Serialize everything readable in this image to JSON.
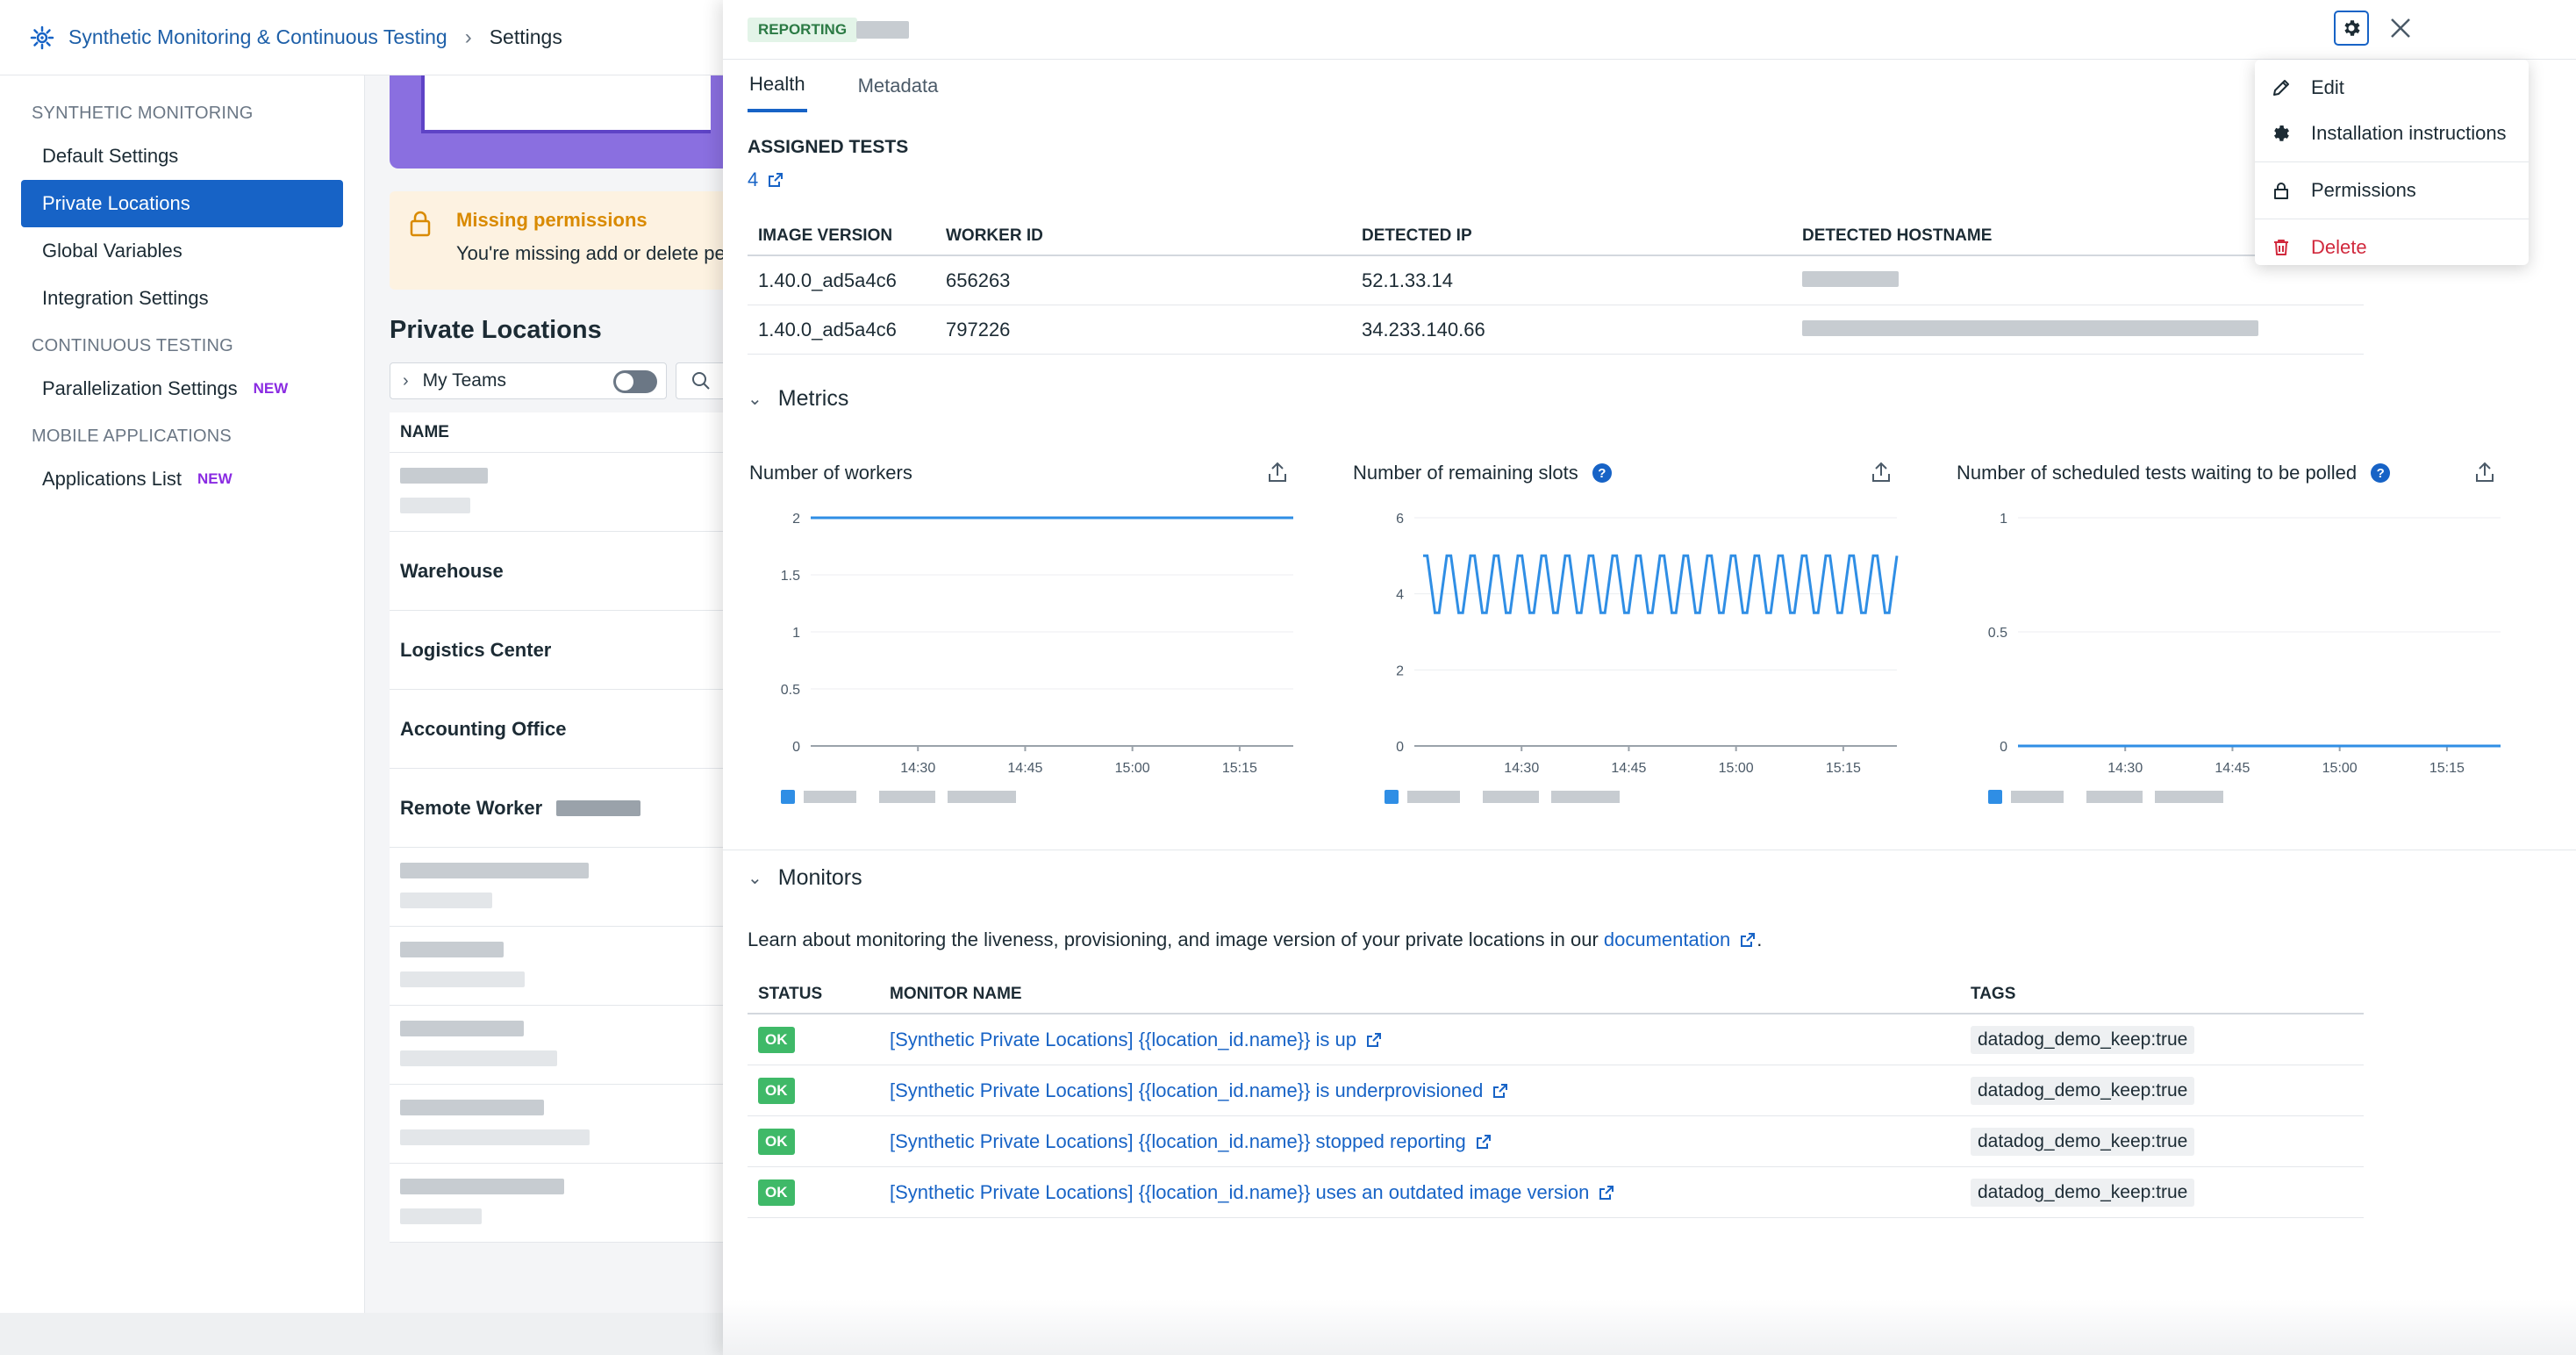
{
  "breadcrumb": {
    "product": "Synthetic Monitoring & Continuous Testing",
    "current": "Settings"
  },
  "sidenav": {
    "sections": [
      {
        "title": "SYNTHETIC MONITORING",
        "items": [
          {
            "label": "Default Settings",
            "active": false,
            "badge": ""
          },
          {
            "label": "Private Locations",
            "active": true,
            "badge": ""
          },
          {
            "label": "Global Variables",
            "active": false,
            "badge": ""
          },
          {
            "label": "Integration Settings",
            "active": false,
            "badge": ""
          }
        ]
      },
      {
        "title": "CONTINUOUS TESTING",
        "items": [
          {
            "label": "Parallelization Settings",
            "active": false,
            "badge": "NEW"
          }
        ]
      },
      {
        "title": "MOBILE APPLICATIONS",
        "items": [
          {
            "label": "Applications List",
            "active": false,
            "badge": "NEW"
          }
        ]
      }
    ]
  },
  "background_page": {
    "warning_title": "Missing permissions",
    "warning_text": "You're missing add or delete pe",
    "list_title": "Private Locations",
    "filter_label": "My Teams",
    "column_name": "NAME",
    "rows": [
      "",
      "Warehouse",
      "Logistics Center",
      "Accounting Office",
      "Remote Worker",
      "",
      "",
      "",
      "",
      ""
    ]
  },
  "drawer": {
    "status": "REPORTING",
    "tabs": [
      "Health",
      "Metadata"
    ],
    "active_tab": "Health",
    "assigned_tests_label": "ASSIGNED TESTS",
    "assigned_tests_count": "4",
    "workers_table": {
      "columns": [
        "IMAGE VERSION",
        "WORKER ID",
        "DETECTED IP",
        "DETECTED HOSTNAME"
      ],
      "rows": [
        [
          "1.40.0_ad5a4c6",
          "656263",
          "52.1.33.14",
          ""
        ],
        [
          "1.40.0_ad5a4c6",
          "797226",
          "34.233.140.66",
          ""
        ]
      ]
    },
    "metrics_label": "Metrics",
    "monitors_label": "Monitors",
    "monitors_desc_prefix": "Learn about monitoring the liveness, provisioning, and image version of your private locations in our ",
    "monitors_desc_link": "documentation",
    "monitors_desc_suffix": ".",
    "monitors_table": {
      "columns": [
        "STATUS",
        "MONITOR NAME",
        "TAGS"
      ],
      "rows": [
        {
          "status": "OK",
          "name": "[Synthetic Private Locations] {{location_id.name}} is up",
          "tag_key": "datadog_demo_keep:",
          "tag_val": "true"
        },
        {
          "status": "OK",
          "name": "[Synthetic Private Locations] {{location_id.name}} is underprovisioned",
          "tag_key": "datadog_demo_keep:",
          "tag_val": "true"
        },
        {
          "status": "OK",
          "name": "[Synthetic Private Locations] {{location_id.name}} stopped reporting",
          "tag_key": "datadog_demo_keep:",
          "tag_val": "true"
        },
        {
          "status": "OK",
          "name": "[Synthetic Private Locations] {{location_id.name}} uses an outdated image version",
          "tag_key": "datadog_demo_keep:",
          "tag_val": "true"
        }
      ]
    }
  },
  "menu": {
    "items": [
      {
        "label": "Edit",
        "icon": "pencil-icon",
        "danger": false
      },
      {
        "label": "Installation instructions",
        "icon": "gear-icon",
        "danger": false
      },
      {
        "label": "Permissions",
        "icon": "lock-icon",
        "danger": false
      },
      {
        "label": "Delete",
        "icon": "trash-icon",
        "danger": true
      }
    ]
  },
  "colors": {
    "accent": "#1763c6",
    "ok": "#3fb968",
    "danger": "#d1293d",
    "series": "#2f8ee5"
  },
  "chart_data": [
    {
      "type": "line",
      "title": "Number of workers",
      "x_ticks": [
        "14:30",
        "14:45",
        "15:00",
        "15:15"
      ],
      "y_ticks": [
        "0",
        "0.5",
        "1",
        "1.5",
        "2"
      ],
      "ylim": [
        0,
        2
      ],
      "xlim": [
        14.25,
        15.375
      ],
      "series": [
        {
          "x": [
            14.25,
            15.375
          ],
          "y": [
            2,
            2
          ]
        }
      ]
    },
    {
      "type": "line",
      "title": "Number of remaining slots",
      "x_ticks": [
        "14:30",
        "14:45",
        "15:00",
        "15:15"
      ],
      "y_ticks": [
        "0",
        "2",
        "4",
        "6"
      ],
      "ylim": [
        0,
        6
      ],
      "xlim": [
        14.25,
        15.375
      ],
      "series": [
        {
          "oscillates_between": [
            3.5,
            5
          ],
          "cycles": 20
        }
      ]
    },
    {
      "type": "line",
      "title": "Number of scheduled tests waiting to be polled",
      "x_ticks": [
        "14:30",
        "14:45",
        "15:00",
        "15:15"
      ],
      "y_ticks": [
        "0",
        "0.5",
        "1"
      ],
      "ylim": [
        0,
        1
      ],
      "xlim": [
        14.25,
        15.375
      ],
      "series": [
        {
          "x": [
            14.25,
            15.375
          ],
          "y": [
            0,
            0
          ]
        }
      ]
    }
  ]
}
